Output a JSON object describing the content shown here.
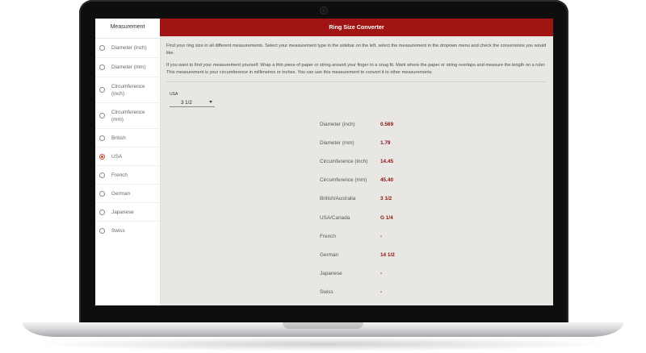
{
  "sidebar": {
    "title": "Measurement",
    "items": [
      {
        "label": "Diameter (inch)",
        "selected": false
      },
      {
        "label": "Diameter (mm)",
        "selected": false
      },
      {
        "label": "Circumference (inch)",
        "selected": false
      },
      {
        "label": "Circumference (mm)",
        "selected": false
      },
      {
        "label": "British",
        "selected": false
      },
      {
        "label": "USA",
        "selected": true
      },
      {
        "label": "French",
        "selected": false
      },
      {
        "label": "German",
        "selected": false
      },
      {
        "label": "Japanese",
        "selected": false
      },
      {
        "label": "Swiss",
        "selected": false
      }
    ]
  },
  "header": {
    "title": "Ring Size Converter"
  },
  "intro": {
    "p1": "Find your ring size in all different measurements. Select your measurement type in the sidebar on the left, select the measurement in the dropown menu and check the conversions you would like.",
    "p2": "If you want to find your measurement yourself. Wrap a thin piece of paper or string around your finger to a snug fit. Mark where the paper or string overlaps and measure the length on a ruler. This measurement is your circumference in millimetres or inches. You can use this measurement to convert it to other measurements"
  },
  "select": {
    "label": "USA",
    "value": "3 1/2"
  },
  "results": [
    {
      "label": "Diameter (inch)",
      "value": "0.569"
    },
    {
      "label": "Diameter (mm)",
      "value": "1.79"
    },
    {
      "label": "Circumference (inch)",
      "value": "14.45"
    },
    {
      "label": "Circumference (mm)",
      "value": "45.40"
    },
    {
      "label": "British/Australia",
      "value": "3 1/2"
    },
    {
      "label": "USA/Canada",
      "value": "G 1/4"
    },
    {
      "label": "French",
      "value": "-"
    },
    {
      "label": "German",
      "value": "14 1/2"
    },
    {
      "label": "Japanese",
      "value": "-"
    },
    {
      "label": "Swiss",
      "value": "-"
    }
  ],
  "colors": {
    "header_bg": "#a01414",
    "accent": "#c4503a",
    "value_text": "#8a1010"
  }
}
